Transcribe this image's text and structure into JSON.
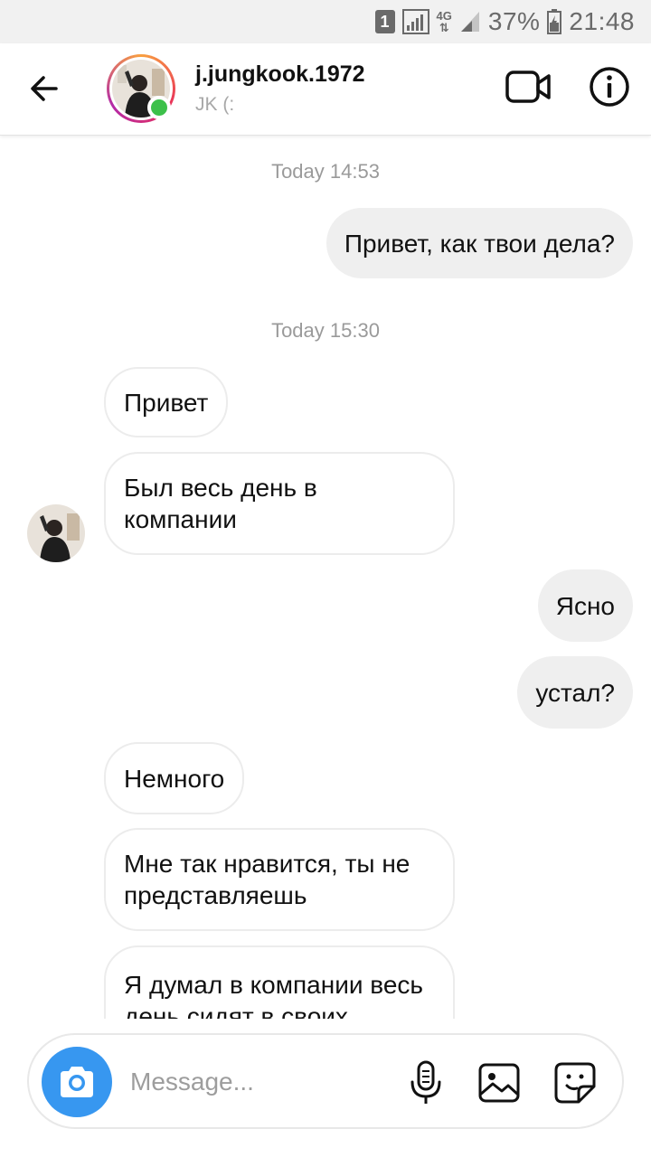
{
  "status_bar": {
    "sim": "1",
    "network": "4G",
    "battery": "37%",
    "time": "21:48"
  },
  "header": {
    "username": "j.jungkook.1972",
    "subtitle": "JK (:"
  },
  "messages": [
    {
      "kind": "timestamp",
      "text": "Today 14:53"
    },
    {
      "kind": "out",
      "text": "Привет, как твои дела?"
    },
    {
      "kind": "timestamp",
      "text": "Today 15:30"
    },
    {
      "kind": "in",
      "text": "Привет"
    },
    {
      "kind": "in",
      "text": "Был весь день в компании"
    },
    {
      "kind": "out",
      "text": "Ясно"
    },
    {
      "kind": "out",
      "text": "устал?"
    },
    {
      "kind": "in",
      "text": "Немного"
    },
    {
      "kind": "in",
      "text": "Мне так нравится, ты не представляешь"
    },
    {
      "kind": "in",
      "text": "Я думал в компании весь день сидят в своих"
    }
  ],
  "composer": {
    "placeholder": "Message..."
  },
  "icons": {
    "back": "arrow-left-icon",
    "video": "video-camera-icon",
    "info": "info-icon",
    "camera": "camera-icon",
    "mic": "microphone-icon",
    "gallery": "image-icon",
    "sticker": "sticker-icon"
  },
  "colors": {
    "accent_blue": "#3797f0",
    "online_green": "#3cc04a",
    "outgoing_bubble": "#efefef"
  }
}
